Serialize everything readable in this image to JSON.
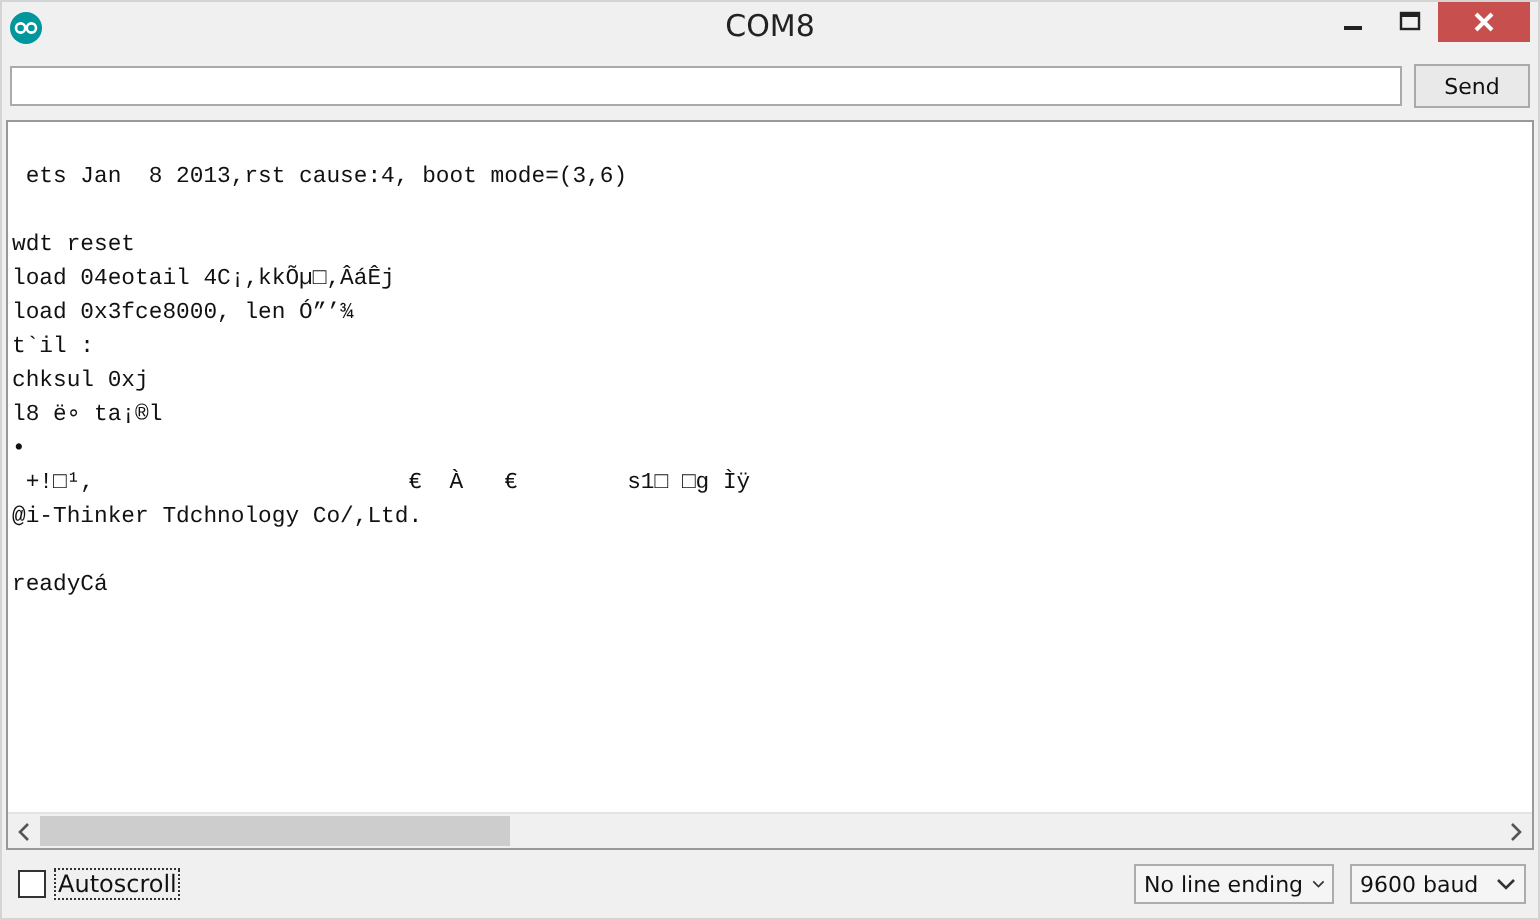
{
  "window": {
    "title": "COM8"
  },
  "send_button": "Send",
  "output_blocks": [
    [
      " ets Jan  8 2013,rst cause:4, boot mode=(3,6)"
    ],
    [
      "wdt reset",
      "load 04eotail 4C¡,kkÕµ□,ÂáÊj",
      "load 0x3fce8000, len Ó”’¾",
      "t`il :",
      "chksul 0xj",
      "l8 ë∘ ta¡®l",
      "•",
      " +!□¹,                       €  À   €        s1□ □g Ìÿ",
      "@i-Thinker Tdchnology Co/,Ltd."
    ],
    [
      "readyCá"
    ]
  ],
  "autoscroll": {
    "label": "Autoscroll",
    "checked": false
  },
  "line_ending": "No line ending",
  "baud": "9600 baud"
}
